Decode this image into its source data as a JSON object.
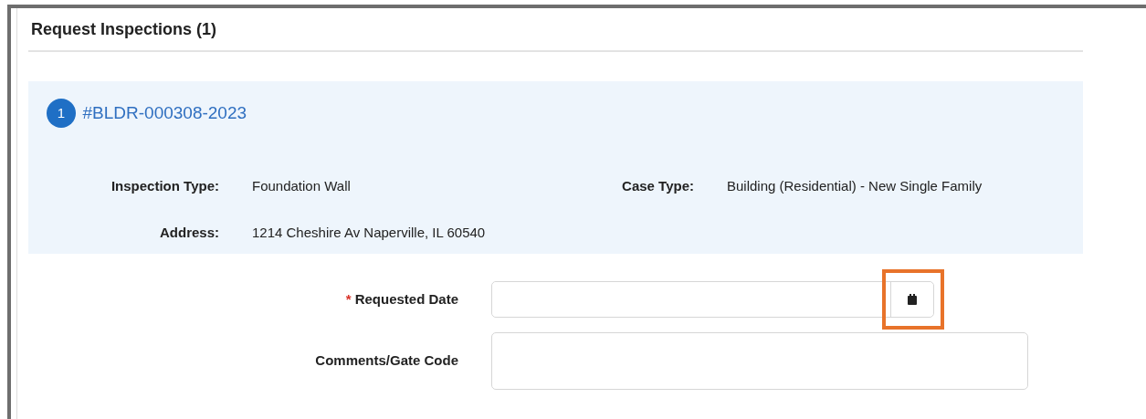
{
  "title": "Request Inspections (1)",
  "case": {
    "number": "1",
    "link": "#BLDR-000308-2023",
    "details": [
      {
        "label": "Inspection Type:",
        "value": "Foundation Wall"
      },
      {
        "label": "Case Type:",
        "value": "Building (Residential) - New Single Family"
      },
      {
        "label": "Address:",
        "value": "1214 Cheshire Av Naperville, IL 60540"
      }
    ]
  },
  "fields": [
    {
      "kind": "date",
      "required_marker": "*",
      "label": "Requested Date",
      "highlighted": true
    },
    {
      "kind": "textarea",
      "label": "Comments/Gate Code",
      "highlighted": false
    }
  ]
}
